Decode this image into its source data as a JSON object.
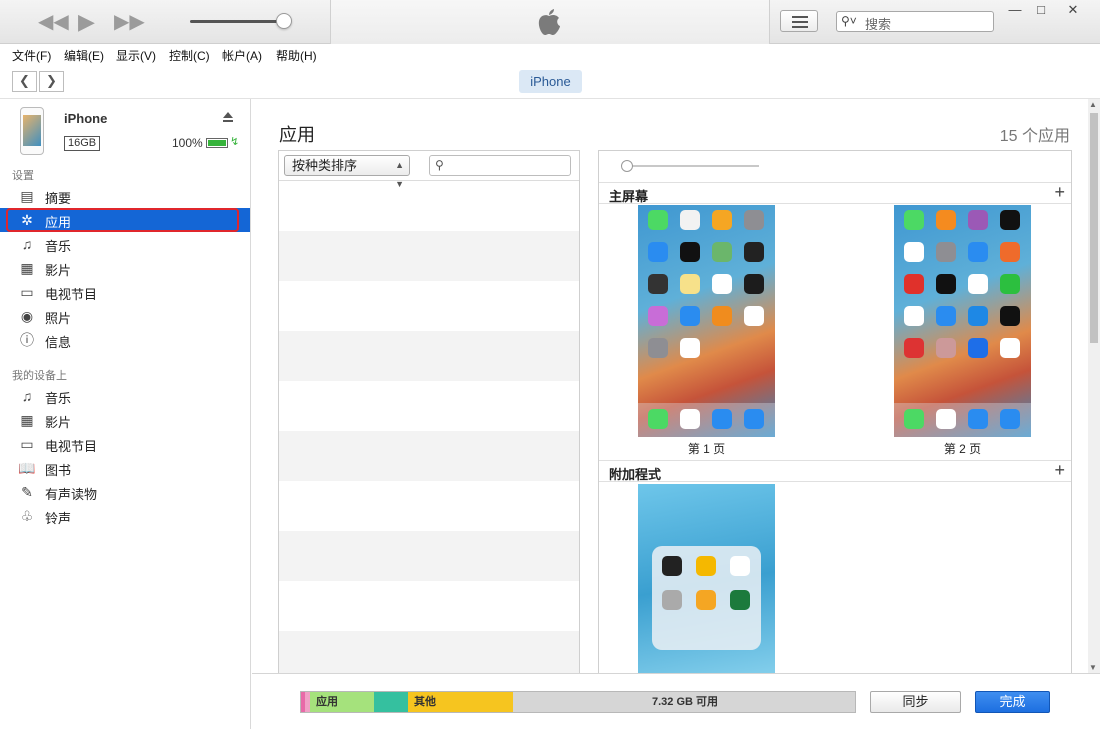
{
  "menu": [
    "文件(F)",
    "编辑(E)",
    "显示(V)",
    "控制(C)",
    "帐户(A)",
    "帮助(H)"
  ],
  "search": {
    "placeholder": "搜索"
  },
  "device_tab": "iPhone",
  "device": {
    "name": "iPhone",
    "capacity": "16GB",
    "battery": "100%"
  },
  "sidebar": {
    "settings_title": "设置",
    "settings_items": [
      {
        "label": "摘要",
        "icon": "summary-icon"
      },
      {
        "label": "应用",
        "icon": "app-store-icon",
        "active": true
      },
      {
        "label": "音乐",
        "icon": "music-icon"
      },
      {
        "label": "影片",
        "icon": "film-icon"
      },
      {
        "label": "电视节目",
        "icon": "tv-icon"
      },
      {
        "label": "照片",
        "icon": "camera-icon"
      },
      {
        "label": "信息",
        "icon": "info-icon"
      }
    ],
    "on_device_title": "我的设备上",
    "on_device_items": [
      {
        "label": "音乐",
        "icon": "music-icon"
      },
      {
        "label": "影片",
        "icon": "film-icon"
      },
      {
        "label": "电视节目",
        "icon": "tv-icon"
      },
      {
        "label": "图书",
        "icon": "book-icon"
      },
      {
        "label": "有声读物",
        "icon": "audiobook-icon"
      },
      {
        "label": "铃声",
        "icon": "bell-icon"
      }
    ]
  },
  "main": {
    "title": "应用",
    "count": "15 个应用",
    "sort_label": "按种类排序",
    "home_screens_title": "主屏幕",
    "pages": [
      "第 1 页",
      "第 2 页"
    ],
    "extras_title": "附加程式"
  },
  "capacity": {
    "segments": [
      {
        "label": "",
        "color": "#e86aa8"
      },
      {
        "label": "",
        "color": "#f0a1c6"
      },
      {
        "label": "应用",
        "color": "#a5e27c"
      },
      {
        "label": "",
        "color": "#35c09f"
      },
      {
        "label": "其他",
        "color": "#f6c51f"
      }
    ],
    "free": "7.32 GB 可用"
  },
  "buttons": {
    "sync": "同步",
    "done": "完成"
  }
}
